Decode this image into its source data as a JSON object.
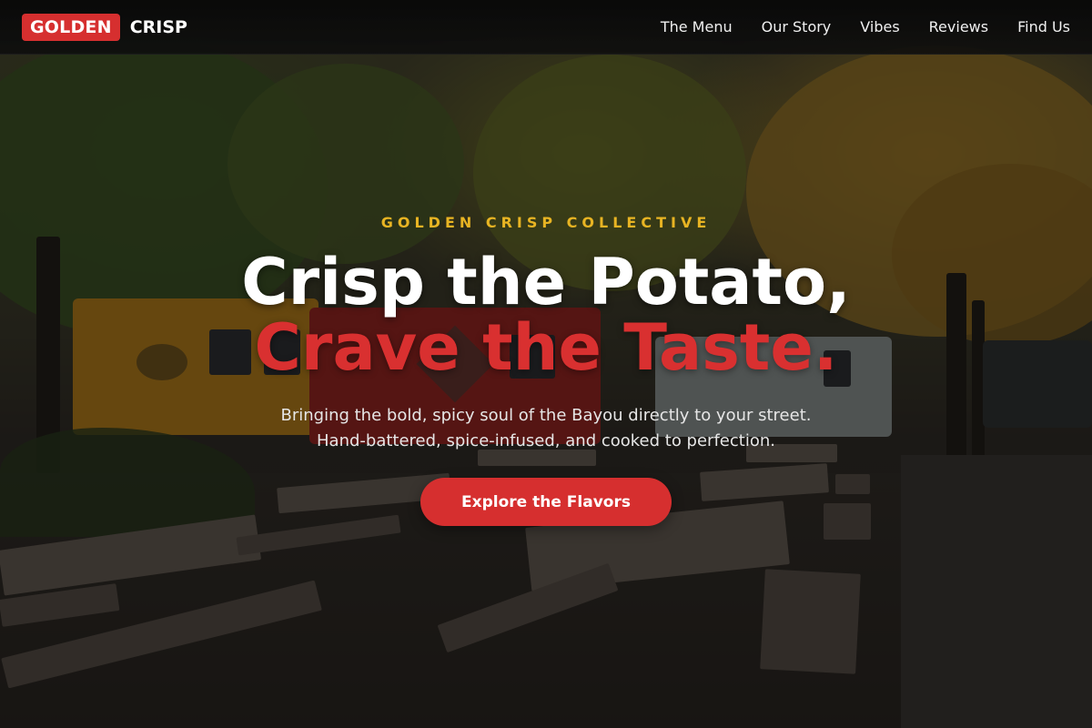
{
  "nav": {
    "brand_badge": "GOLDEN",
    "brand_text": "CRISP",
    "links": [
      "The Menu",
      "Our Story",
      "Vibes",
      "Reviews",
      "Find Us"
    ]
  },
  "hero": {
    "eyebrow": "GOLDEN CRISP COLLECTIVE",
    "headline_line1": "Crisp the Potato,",
    "headline_line2": "Crave the Taste.",
    "subtext_line1": "Bringing the bold, spicy soul of the Bayou directly to your street.",
    "subtext_line2": "Hand-battered, spice-infused, and cooked to perfection.",
    "cta_label": "Explore the Flavors",
    "background_image": "food-truck-park-with-picnic-tables"
  },
  "colors": {
    "accent_red": "#d62f2f",
    "eyebrow_gold": "#e8b423",
    "navbar_bg": "#0e0e0e"
  }
}
